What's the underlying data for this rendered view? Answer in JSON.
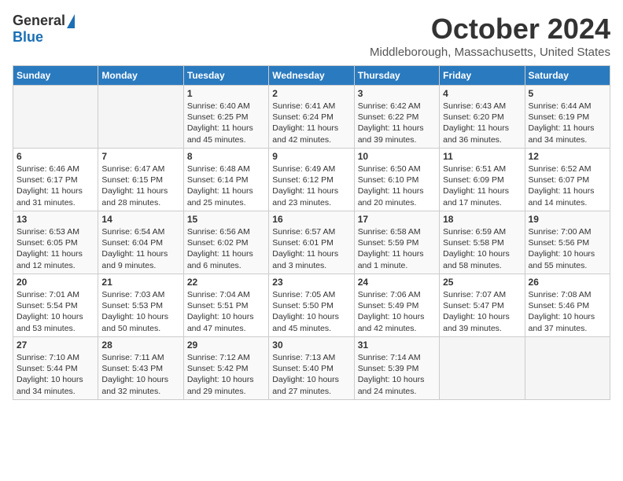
{
  "logo": {
    "general": "General",
    "blue": "Blue"
  },
  "title": "October 2024",
  "location": "Middleborough, Massachusetts, United States",
  "headers": [
    "Sunday",
    "Monday",
    "Tuesday",
    "Wednesday",
    "Thursday",
    "Friday",
    "Saturday"
  ],
  "weeks": [
    [
      {
        "day": "",
        "info": ""
      },
      {
        "day": "",
        "info": ""
      },
      {
        "day": "1",
        "info": "Sunrise: 6:40 AM\nSunset: 6:25 PM\nDaylight: 11 hours and 45 minutes."
      },
      {
        "day": "2",
        "info": "Sunrise: 6:41 AM\nSunset: 6:24 PM\nDaylight: 11 hours and 42 minutes."
      },
      {
        "day": "3",
        "info": "Sunrise: 6:42 AM\nSunset: 6:22 PM\nDaylight: 11 hours and 39 minutes."
      },
      {
        "day": "4",
        "info": "Sunrise: 6:43 AM\nSunset: 6:20 PM\nDaylight: 11 hours and 36 minutes."
      },
      {
        "day": "5",
        "info": "Sunrise: 6:44 AM\nSunset: 6:19 PM\nDaylight: 11 hours and 34 minutes."
      }
    ],
    [
      {
        "day": "6",
        "info": "Sunrise: 6:46 AM\nSunset: 6:17 PM\nDaylight: 11 hours and 31 minutes."
      },
      {
        "day": "7",
        "info": "Sunrise: 6:47 AM\nSunset: 6:15 PM\nDaylight: 11 hours and 28 minutes."
      },
      {
        "day": "8",
        "info": "Sunrise: 6:48 AM\nSunset: 6:14 PM\nDaylight: 11 hours and 25 minutes."
      },
      {
        "day": "9",
        "info": "Sunrise: 6:49 AM\nSunset: 6:12 PM\nDaylight: 11 hours and 23 minutes."
      },
      {
        "day": "10",
        "info": "Sunrise: 6:50 AM\nSunset: 6:10 PM\nDaylight: 11 hours and 20 minutes."
      },
      {
        "day": "11",
        "info": "Sunrise: 6:51 AM\nSunset: 6:09 PM\nDaylight: 11 hours and 17 minutes."
      },
      {
        "day": "12",
        "info": "Sunrise: 6:52 AM\nSunset: 6:07 PM\nDaylight: 11 hours and 14 minutes."
      }
    ],
    [
      {
        "day": "13",
        "info": "Sunrise: 6:53 AM\nSunset: 6:05 PM\nDaylight: 11 hours and 12 minutes."
      },
      {
        "day": "14",
        "info": "Sunrise: 6:54 AM\nSunset: 6:04 PM\nDaylight: 11 hours and 9 minutes."
      },
      {
        "day": "15",
        "info": "Sunrise: 6:56 AM\nSunset: 6:02 PM\nDaylight: 11 hours and 6 minutes."
      },
      {
        "day": "16",
        "info": "Sunrise: 6:57 AM\nSunset: 6:01 PM\nDaylight: 11 hours and 3 minutes."
      },
      {
        "day": "17",
        "info": "Sunrise: 6:58 AM\nSunset: 5:59 PM\nDaylight: 11 hours and 1 minute."
      },
      {
        "day": "18",
        "info": "Sunrise: 6:59 AM\nSunset: 5:58 PM\nDaylight: 10 hours and 58 minutes."
      },
      {
        "day": "19",
        "info": "Sunrise: 7:00 AM\nSunset: 5:56 PM\nDaylight: 10 hours and 55 minutes."
      }
    ],
    [
      {
        "day": "20",
        "info": "Sunrise: 7:01 AM\nSunset: 5:54 PM\nDaylight: 10 hours and 53 minutes."
      },
      {
        "day": "21",
        "info": "Sunrise: 7:03 AM\nSunset: 5:53 PM\nDaylight: 10 hours and 50 minutes."
      },
      {
        "day": "22",
        "info": "Sunrise: 7:04 AM\nSunset: 5:51 PM\nDaylight: 10 hours and 47 minutes."
      },
      {
        "day": "23",
        "info": "Sunrise: 7:05 AM\nSunset: 5:50 PM\nDaylight: 10 hours and 45 minutes."
      },
      {
        "day": "24",
        "info": "Sunrise: 7:06 AM\nSunset: 5:49 PM\nDaylight: 10 hours and 42 minutes."
      },
      {
        "day": "25",
        "info": "Sunrise: 7:07 AM\nSunset: 5:47 PM\nDaylight: 10 hours and 39 minutes."
      },
      {
        "day": "26",
        "info": "Sunrise: 7:08 AM\nSunset: 5:46 PM\nDaylight: 10 hours and 37 minutes."
      }
    ],
    [
      {
        "day": "27",
        "info": "Sunrise: 7:10 AM\nSunset: 5:44 PM\nDaylight: 10 hours and 34 minutes."
      },
      {
        "day": "28",
        "info": "Sunrise: 7:11 AM\nSunset: 5:43 PM\nDaylight: 10 hours and 32 minutes."
      },
      {
        "day": "29",
        "info": "Sunrise: 7:12 AM\nSunset: 5:42 PM\nDaylight: 10 hours and 29 minutes."
      },
      {
        "day": "30",
        "info": "Sunrise: 7:13 AM\nSunset: 5:40 PM\nDaylight: 10 hours and 27 minutes."
      },
      {
        "day": "31",
        "info": "Sunrise: 7:14 AM\nSunset: 5:39 PM\nDaylight: 10 hours and 24 minutes."
      },
      {
        "day": "",
        "info": ""
      },
      {
        "day": "",
        "info": ""
      }
    ]
  ]
}
